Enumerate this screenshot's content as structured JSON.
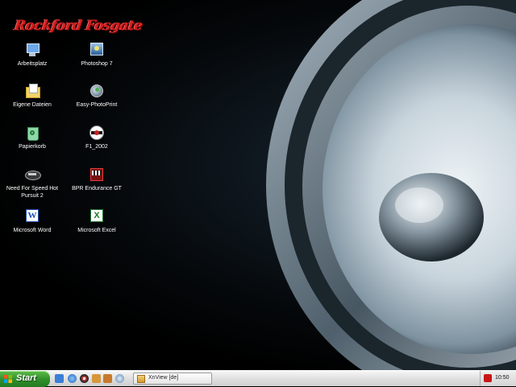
{
  "brand": "Rockford Fosgate",
  "icons": [
    {
      "label": "Arbeitsplatz",
      "icon": "my-computer-icon"
    },
    {
      "label": "Photoshop 7",
      "icon": "photoshop-icon"
    },
    {
      "label": "Eigene Dateien",
      "icon": "my-documents-icon"
    },
    {
      "label": "Easy-PhotoPrint",
      "icon": "photoprint-icon"
    },
    {
      "label": "Papierkorb",
      "icon": "recycle-bin-icon"
    },
    {
      "label": "F1_2002",
      "icon": "f1-game-icon"
    },
    {
      "label": "Need For Speed Hot Pursuit 2",
      "icon": "nfs-game-icon"
    },
    {
      "label": "BPR Endurance GT",
      "icon": "bpr-game-icon"
    },
    {
      "label": "Microsoft Word",
      "icon": "word-icon"
    },
    {
      "label": "Microsoft Excel",
      "icon": "excel-icon"
    }
  ],
  "taskbar": {
    "start_label": "Start",
    "task_label": "XnView [de]",
    "clock": "10:50"
  },
  "colors": {
    "brand": "#d31f1f",
    "start": "#2f8f2a",
    "taskbar": "#dcdcdc"
  }
}
